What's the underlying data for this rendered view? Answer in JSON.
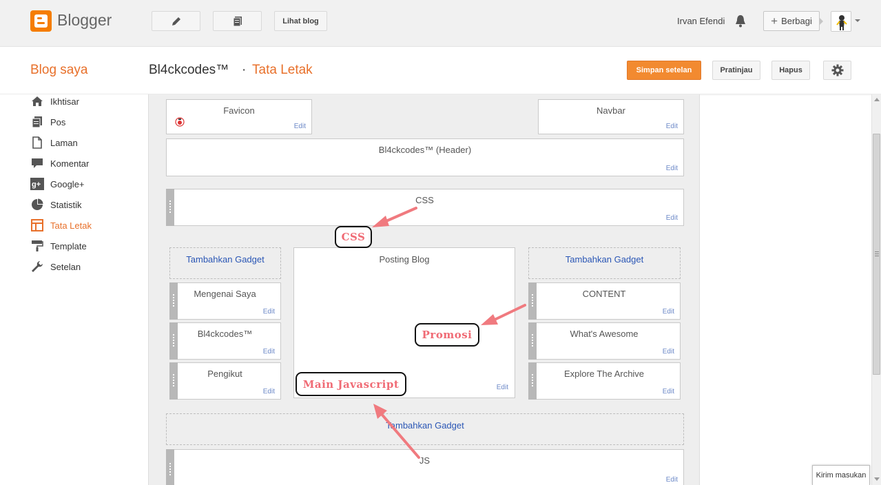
{
  "app": {
    "brand": "Blogger",
    "view_blog_label": "Lihat blog"
  },
  "user": {
    "name": "Irvan Efendi",
    "share_label": "Berbagi"
  },
  "header": {
    "blog_saya": "Blog saya",
    "blog_name": "Bl4ckcodes™",
    "separator": "·",
    "page": "Tata Letak",
    "save_label": "Simpan setelan",
    "preview_label": "Pratinjau",
    "delete_label": "Hapus"
  },
  "sidebar": {
    "items": [
      {
        "label": "Ikhtisar",
        "icon": "home-icon"
      },
      {
        "label": "Pos",
        "icon": "posts-icon"
      },
      {
        "label": "Laman",
        "icon": "page-icon"
      },
      {
        "label": "Komentar",
        "icon": "comment-icon"
      },
      {
        "label": "Google+",
        "icon": "google-plus-icon"
      },
      {
        "label": "Statistik",
        "icon": "pie-chart-icon"
      },
      {
        "label": "Tata Letak",
        "icon": "layout-icon",
        "active": true
      },
      {
        "label": "Template",
        "icon": "paint-roller-icon"
      },
      {
        "label": "Setelan",
        "icon": "wrench-icon"
      }
    ]
  },
  "layout": {
    "edit_label": "Edit",
    "add_gadget_label": "Tambahkan Gadget",
    "favicon": "Favicon",
    "navbar": "Navbar",
    "header_gadget": "Bl4ckcodes™ (Header)",
    "css_gadget": "CSS",
    "posting": "Posting Blog",
    "left_gadgets": [
      "Mengenai Saya",
      "Bl4ckcodes™",
      "Pengikut"
    ],
    "right_gadgets": [
      "CONTENT",
      "What's Awesome",
      "Explore The Archive"
    ],
    "js_gadget": "JS"
  },
  "annotations": {
    "css": "CSS",
    "promosi": "Promosi",
    "main_js": "Main Javascript"
  },
  "feedback_label": "Kirim masukan",
  "colors": {
    "accent": "#e8702a",
    "brand": "#f57d00",
    "link": "#2a56b5",
    "annotation": "#f06b75"
  }
}
